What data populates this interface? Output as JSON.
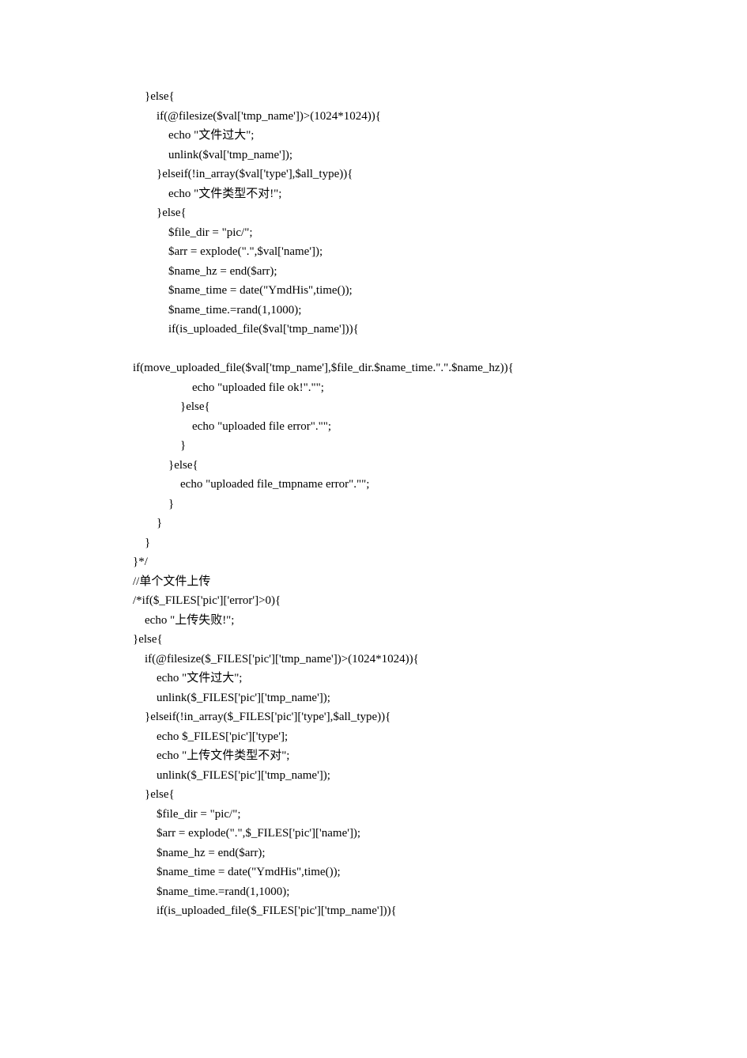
{
  "code_lines": [
    "    }else{",
    "        if(@filesize($val['tmp_name'])>(1024*1024)){",
    "            echo \"文件过大\";",
    "            unlink($val['tmp_name']);",
    "        }elseif(!in_array($val['type'],$all_type)){",
    "            echo \"文件类型不对!\";",
    "        }else{",
    "            $file_dir = \"pic/\";",
    "            $arr = explode(\".\",$val['name']);",
    "            $name_hz = end($arr);",
    "            $name_time = date(\"YmdHis\",time());",
    "            $name_time.=rand(1,1000);",
    "            if(is_uploaded_file($val['tmp_name'])){",
    "",
    "if(move_uploaded_file($val['tmp_name'],$file_dir.$name_time.\".\".$name_hz)){",
    "                    echo \"uploaded file ok!\".\"\";",
    "                }else{",
    "                    echo \"uploaded file error\".\"\";",
    "                }",
    "            }else{",
    "                echo \"uploaded file_tmpname error\".\"\";",
    "            }",
    "        }",
    "    }",
    "}*/",
    "//单个文件上传",
    "/*if($_FILES['pic']['error']>0){",
    "    echo \"上传失败!\";",
    "}else{",
    "    if(@filesize($_FILES['pic']['tmp_name'])>(1024*1024)){",
    "        echo \"文件过大\";",
    "        unlink($_FILES['pic']['tmp_name']);",
    "    }elseif(!in_array($_FILES['pic']['type'],$all_type)){",
    "        echo $_FILES['pic']['type'];",
    "        echo \"上传文件类型不对\";",
    "        unlink($_FILES['pic']['tmp_name']);",
    "    }else{",
    "        $file_dir = \"pic/\";",
    "        $arr = explode(\".\",$_FILES['pic']['name']);",
    "        $name_hz = end($arr);",
    "        $name_time = date(\"YmdHis\",time());",
    "        $name_time.=rand(1,1000);",
    "        if(is_uploaded_file($_FILES['pic']['tmp_name'])){"
  ]
}
